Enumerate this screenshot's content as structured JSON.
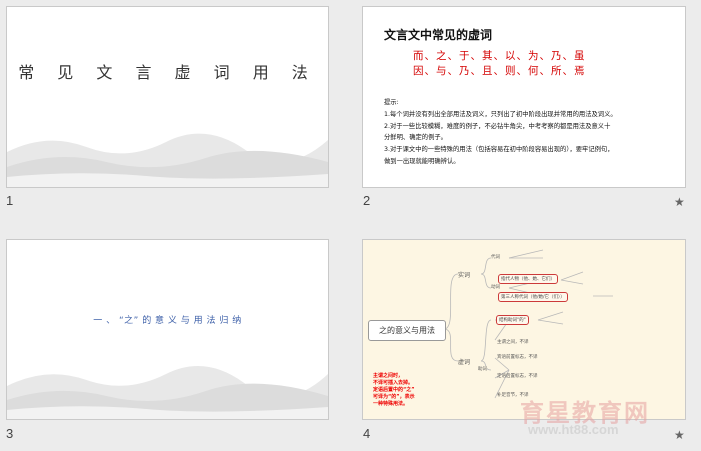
{
  "slides": [
    {
      "number": "1",
      "title": "常 见 文 言 虚 词 用 法"
    },
    {
      "number": "2",
      "title": "文言文中常见的虚词",
      "red_line1": "而、之、于、其、以、为、乃、虽",
      "red_line2": "因、与、乃、且、则、何、所、焉",
      "notes_heading": "提示:",
      "notes": [
        "1.每个词并没有列出全部用法及词义，只列出了初中阶段出现并常用的用法及词义。",
        "2.对于一些比较模糊，难度的例子，不必钻牛角尖，中考考察的都是用法及意义十",
        "分鲜明、确定的例子。",
        "3.对于课文中的一些特殊的用法（包括容易在初中阶段容易出现的），要牢记例句，",
        "做到一出现就能明确辨认。"
      ],
      "star": "★"
    },
    {
      "number": "3",
      "title": "一 、 “之” 的 意 义 与 用 法 归 纳"
    },
    {
      "number": "4",
      "mindmap_root": "之的意义与用法",
      "branch_top": "实词",
      "branch_bottom": "虚词",
      "sub_pronoun": "代词",
      "sub_verb": "动词",
      "sub_particle": "助词",
      "box1": "指代人物（他、她、它们）",
      "box2": "第三人称代词（他/她/它（们））",
      "box3": "结构助词\"的\"",
      "leaf_a": "主谓之间，不译",
      "leaf_b": "宾语前置标志，不译",
      "leaf_c": "定语后置标志，不译",
      "leaf_d": "补足音节，不译",
      "red_notes": [
        "主谓之间时，",
        "不译可插入去掉。",
        "定语后置中的“之”",
        "可译为“的”，表示",
        "一种特殊用法。"
      ],
      "star": "★"
    }
  ],
  "watermark": {
    "text_a": "育",
    "text_b": "星",
    "text_c": "教育网",
    "url": "www.ht88.com"
  },
  "colors": {
    "red": "#d40000",
    "blue_title": "#3c5fa8",
    "mindmap_bg": "#fdf6e3"
  }
}
